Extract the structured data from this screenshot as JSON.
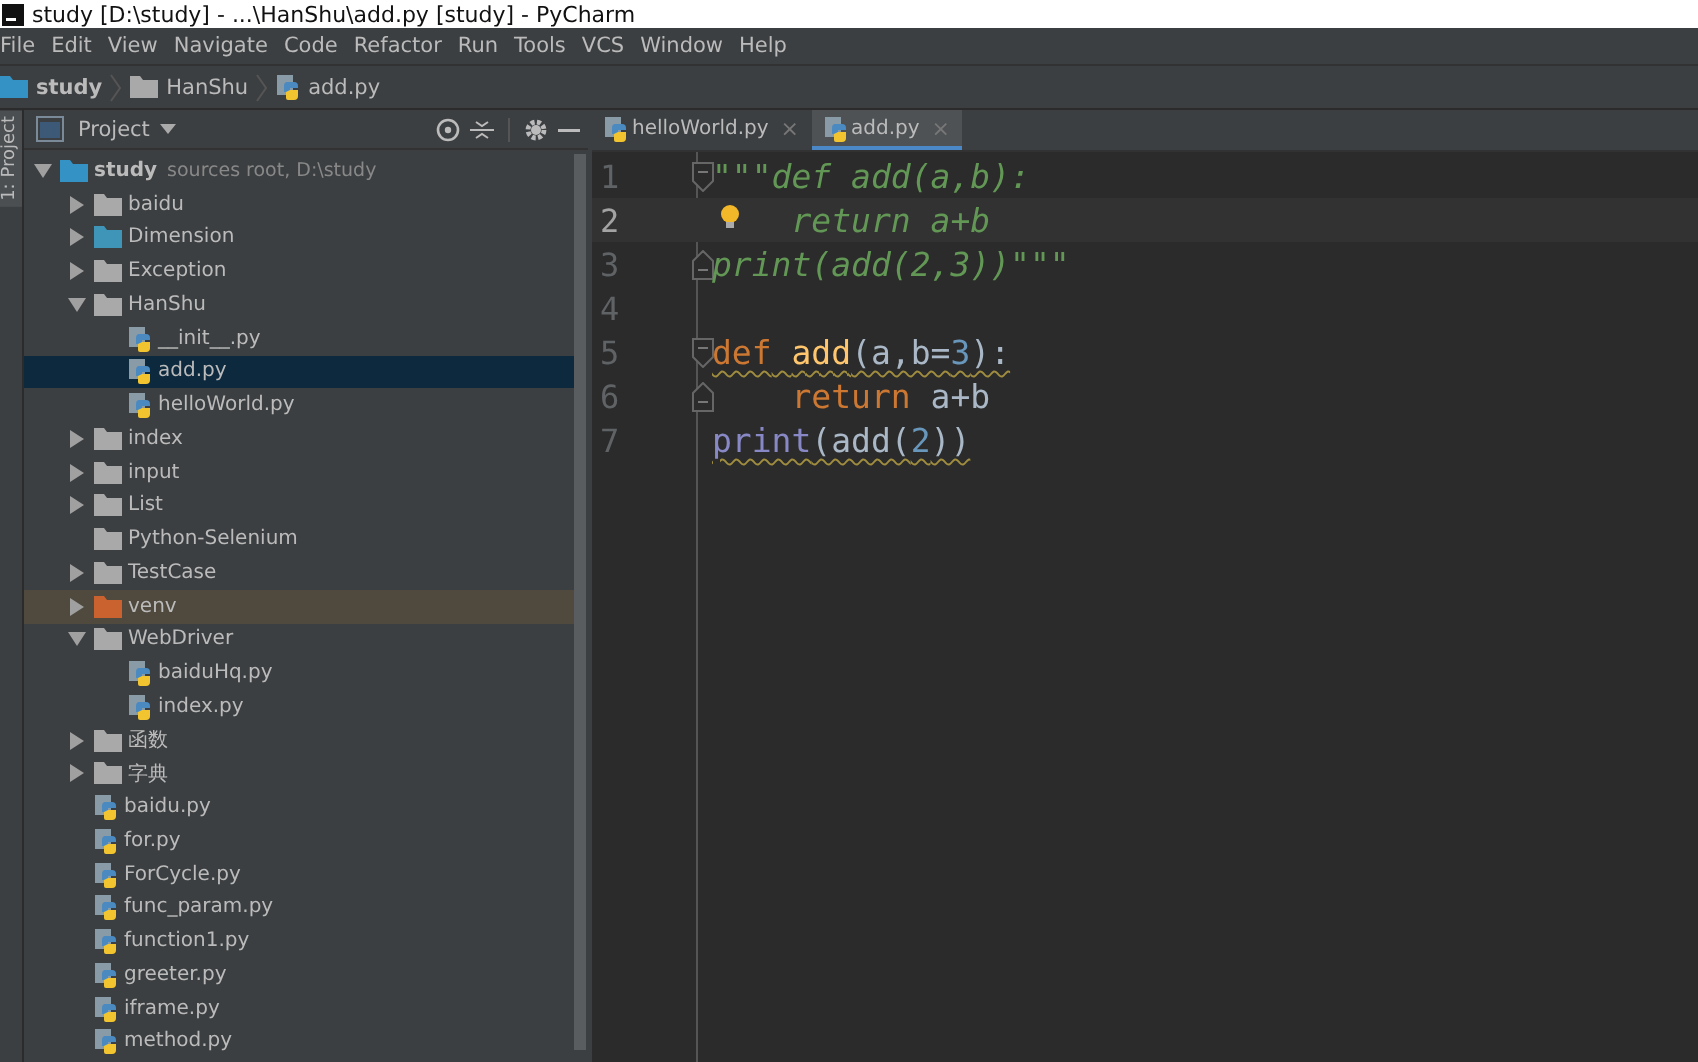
{
  "window": {
    "title": "study [D:\\study] - ...\\HanShu\\add.py [study] - PyCharm"
  },
  "menu": [
    "File",
    "Edit",
    "View",
    "Navigate",
    "Code",
    "Refactor",
    "Run",
    "Tools",
    "VCS",
    "Window",
    "Help"
  ],
  "breadcrumbs": [
    {
      "label": "study",
      "kind": "project"
    },
    {
      "label": "HanShu",
      "kind": "folder"
    },
    {
      "label": "add.py",
      "kind": "file"
    }
  ],
  "side_tab": "1: Project",
  "project_panel": {
    "title": "Project",
    "tree": [
      {
        "name": "study",
        "hint": "sources root,  D:\\study",
        "kind": "folder",
        "expanded": true,
        "selected": false,
        "highlighted": false,
        "color": "#3592c4",
        "children": [
          {
            "name": "baidu",
            "kind": "folder",
            "expanded": false,
            "selected": false,
            "highlighted": false,
            "color": "#a9a9a9"
          },
          {
            "name": "Dimension",
            "kind": "folder",
            "expanded": false,
            "selected": false,
            "highlighted": false,
            "color": "#3f95b8"
          },
          {
            "name": "Exception",
            "kind": "folder",
            "expanded": false,
            "selected": false,
            "highlighted": false,
            "color": "#a9a9a9"
          },
          {
            "name": "HanShu",
            "kind": "folder",
            "expanded": true,
            "selected": false,
            "highlighted": false,
            "color": "#a9a9a9",
            "children": [
              {
                "name": "__init__.py",
                "kind": "file",
                "selected": false,
                "highlighted": false
              },
              {
                "name": "add.py",
                "kind": "file",
                "selected": true,
                "highlighted": false
              },
              {
                "name": "helloWorld.py",
                "kind": "file",
                "selected": false,
                "highlighted": false
              }
            ]
          },
          {
            "name": "index",
            "kind": "folder",
            "expanded": false,
            "selected": false,
            "highlighted": false,
            "color": "#a9a9a9"
          },
          {
            "name": "input",
            "kind": "folder",
            "expanded": false,
            "selected": false,
            "highlighted": false,
            "color": "#a9a9a9"
          },
          {
            "name": "List",
            "kind": "folder",
            "expanded": false,
            "selected": false,
            "highlighted": false,
            "color": "#a9a9a9"
          },
          {
            "name": "Python-Selenium",
            "kind": "empty_folder",
            "selected": false,
            "highlighted": false,
            "color": "#a9a9a9"
          },
          {
            "name": "TestCase",
            "kind": "folder",
            "expanded": false,
            "selected": false,
            "highlighted": false,
            "color": "#a9a9a9"
          },
          {
            "name": "venv",
            "kind": "folder",
            "expanded": false,
            "selected": false,
            "highlighted": true,
            "color": "#c9622f"
          },
          {
            "name": "WebDriver",
            "kind": "folder",
            "expanded": true,
            "selected": false,
            "highlighted": false,
            "color": "#a9a9a9",
            "children": [
              {
                "name": "baiduHq.py",
                "kind": "file",
                "selected": false,
                "highlighted": false
              },
              {
                "name": "index.py",
                "kind": "file",
                "selected": false,
                "highlighted": false
              }
            ]
          },
          {
            "name": "函数",
            "kind": "folder",
            "expanded": false,
            "selected": false,
            "highlighted": false,
            "color": "#a9a9a9"
          },
          {
            "name": "字典",
            "kind": "folder",
            "expanded": false,
            "selected": false,
            "highlighted": false,
            "color": "#a9a9a9"
          },
          {
            "name": "baidu.py",
            "kind": "file",
            "selected": false,
            "highlighted": false
          },
          {
            "name": "for.py",
            "kind": "file",
            "selected": false,
            "highlighted": false
          },
          {
            "name": "ForCycle.py",
            "kind": "file",
            "selected": false,
            "highlighted": false
          },
          {
            "name": "func_param.py",
            "kind": "file",
            "selected": false,
            "highlighted": false
          },
          {
            "name": "function1.py",
            "kind": "file",
            "selected": false,
            "highlighted": false
          },
          {
            "name": "greeter.py",
            "kind": "file",
            "selected": false,
            "highlighted": false
          },
          {
            "name": "iframe.py",
            "kind": "file",
            "selected": false,
            "highlighted": false
          },
          {
            "name": "method.py",
            "kind": "file",
            "selected": false,
            "highlighted": false
          }
        ]
      }
    ]
  },
  "editor_tabs": [
    {
      "label": "helloWorld.py",
      "close": "×",
      "selected": false
    },
    {
      "label": "add.py",
      "close": "×",
      "selected": true
    }
  ],
  "code": [
    {
      "number": "1",
      "current": false,
      "warning": false,
      "indented": false,
      "fold_start": true,
      "tokens": [
        {
          "text": "\"\"\"def add(a,b):",
          "kind": "doc"
        }
      ]
    },
    {
      "number": "2",
      "current": true,
      "warning": false,
      "bulb": true,
      "indented": true,
      "tokens": [
        {
          "text": "return a+b",
          "kind": "doc"
        }
      ]
    },
    {
      "number": "3",
      "current": false,
      "warning": false,
      "indented": false,
      "fold_end": true,
      "tokens": [
        {
          "text": "print(add(2,3))\"\"\"",
          "kind": "doc"
        }
      ]
    },
    {
      "number": "4",
      "current": false
    },
    {
      "number": "5",
      "current": false,
      "warning": true,
      "indented": false,
      "fold_start": true,
      "tokens": [
        {
          "text": "def",
          "kind": "keyword"
        },
        {
          "text": "add",
          "kind": "function"
        },
        {
          "text": "(a,b=",
          "kind": "plain"
        },
        {
          "text": "3",
          "kind": "number"
        },
        {
          "text": "):",
          "kind": "plain"
        }
      ]
    },
    {
      "number": "6",
      "current": false,
      "warning": false,
      "indented": true,
      "fold_end": true,
      "tokens": [
        {
          "text": "return",
          "kind": "keyword"
        },
        {
          "text": "a+b",
          "kind": "plain"
        }
      ]
    },
    {
      "number": "7",
      "current": false,
      "warning": true,
      "indented": false,
      "tokens": [
        {
          "text": "print",
          "kind": "builtin"
        },
        {
          "text": "(add(",
          "kind": "plain"
        },
        {
          "text": "2",
          "kind": "number"
        },
        {
          "text": "))",
          "kind": "plain"
        }
      ]
    }
  ]
}
